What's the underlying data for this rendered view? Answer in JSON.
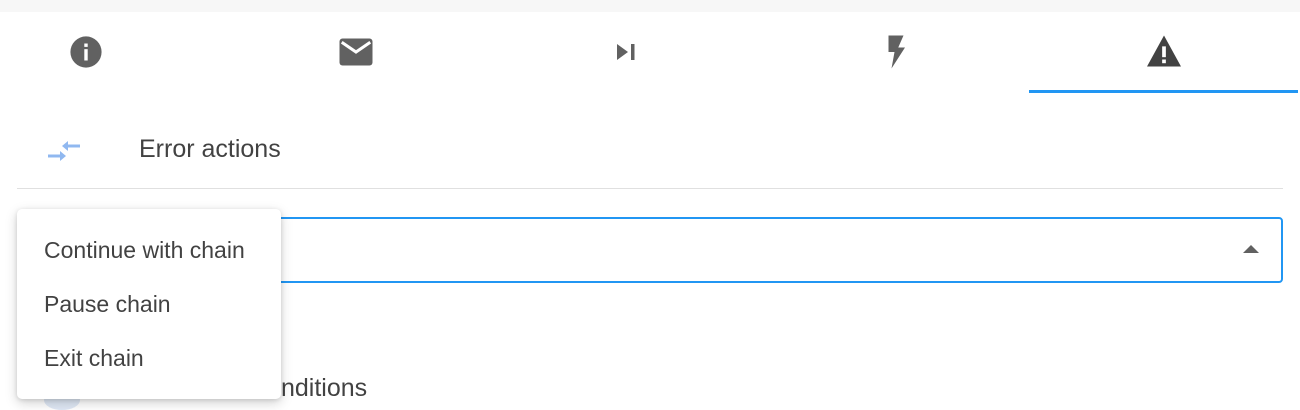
{
  "tabs": [
    {
      "icon": "info-icon",
      "active": false
    },
    {
      "icon": "mail-icon",
      "active": false
    },
    {
      "icon": "skip-next-icon",
      "active": false
    },
    {
      "icon": "flash-icon",
      "active": false
    },
    {
      "icon": "warning-icon",
      "active": true
    }
  ],
  "colors": {
    "accent": "#2196f3",
    "icon": "#616161",
    "text": "#424242",
    "section_icon": "#90b8f0"
  },
  "section": {
    "icon": "swap-arrows-icon",
    "title": "Error actions"
  },
  "select": {
    "value": "",
    "open": true,
    "options": [
      "Continue with chain",
      "Pause chain",
      "Exit chain"
    ]
  },
  "below": {
    "partial_text": "nditions"
  }
}
